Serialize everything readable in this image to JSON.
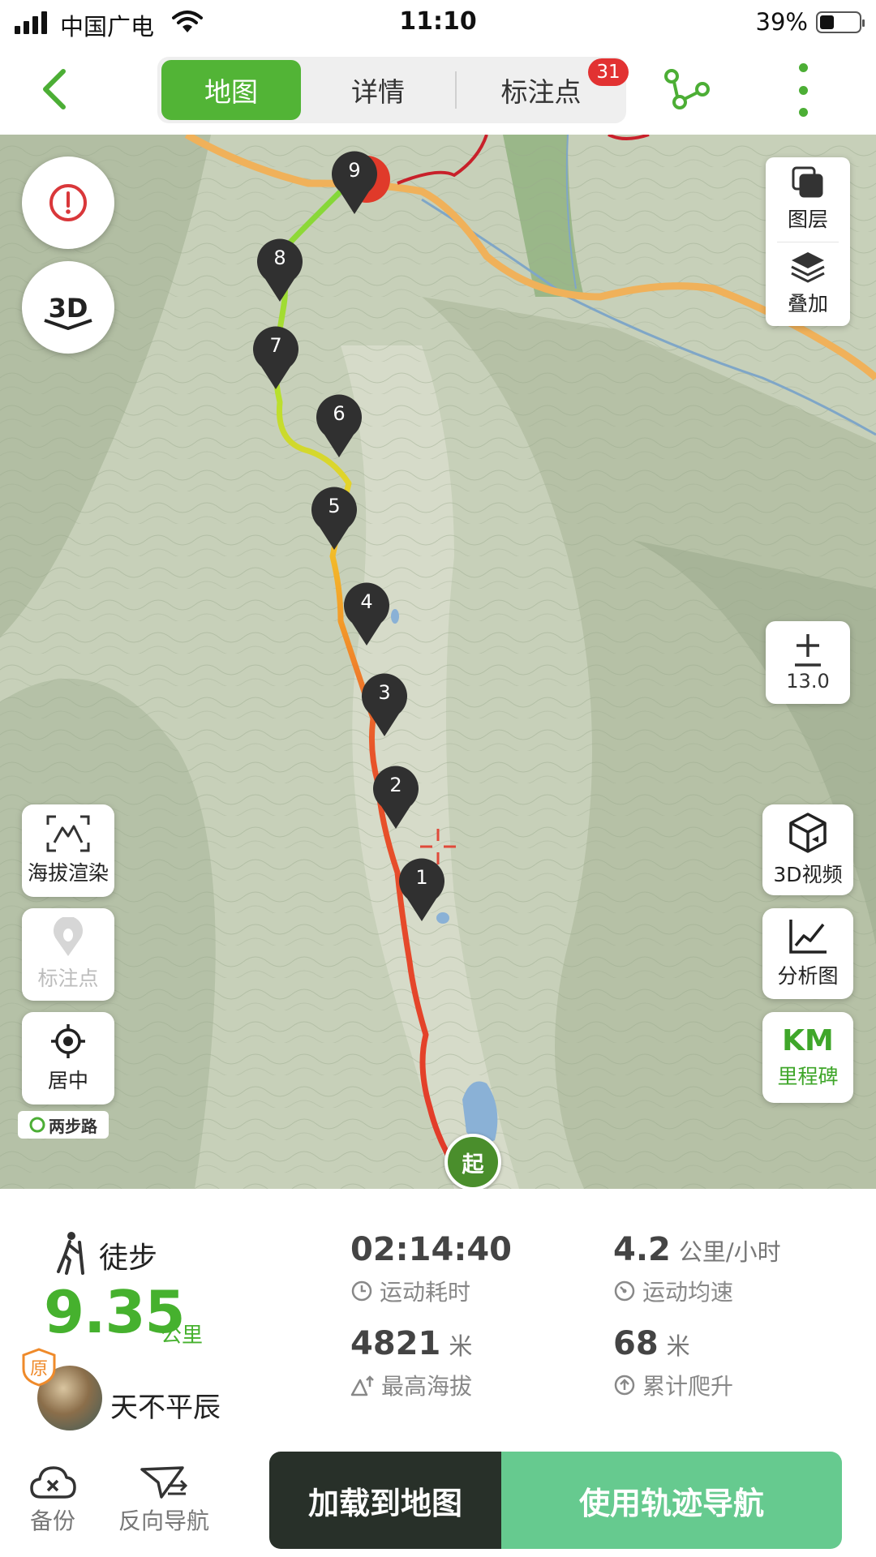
{
  "status_bar": {
    "carrier": "中国广电",
    "time": "11:10",
    "battery": "39%"
  },
  "top_nav": {
    "tabs": [
      {
        "label": "地图",
        "active": true
      },
      {
        "label": "详情",
        "active": false
      },
      {
        "label": "标注点",
        "active": false,
        "badge": "31"
      }
    ]
  },
  "map": {
    "left_buttons": {
      "alert_icon": "exclamation-icon",
      "three_d_icon": "3d-icon",
      "elevation_render": "海拔渲染",
      "mark_point": "标注点",
      "center": "居中"
    },
    "layers_panel": {
      "layer": "图层",
      "overlay": "叠加"
    },
    "zoom_level": "13.0",
    "right_buttons": {
      "video_3d": "3D视频",
      "analysis": "分析图",
      "km_short": "KM",
      "milestone": "里程碑"
    },
    "start_marker": "起",
    "waypoints": [
      "1",
      "2",
      "3",
      "4",
      "5",
      "6",
      "7",
      "8",
      "9"
    ],
    "brand": "两步路",
    "colors": {
      "track_start": "#e23a2a",
      "track_mid": "#f2cf2a",
      "track_end": "#7fd63a",
      "start_marker": "#4a8e2c"
    }
  },
  "stats": {
    "activity": "徒步",
    "distance": "9.35",
    "distance_unit": "公里",
    "username": "天不平辰",
    "orig_badge": "原",
    "duration": "02:14:40",
    "duration_label": "运动耗时",
    "avg_speed": "4.2",
    "avg_speed_unit": "公里/小时",
    "avg_speed_label": "运动均速",
    "max_altitude": "4821",
    "max_altitude_unit": "米",
    "max_altitude_label": "最高海拔",
    "ascent": "68",
    "ascent_unit": "米",
    "ascent_label": "累计爬升"
  },
  "bottom_bar": {
    "backup": "备份",
    "reverse_nav": "反向导航",
    "load_to_map": "加载到地图",
    "use_track_nav": "使用轨迹导航"
  }
}
